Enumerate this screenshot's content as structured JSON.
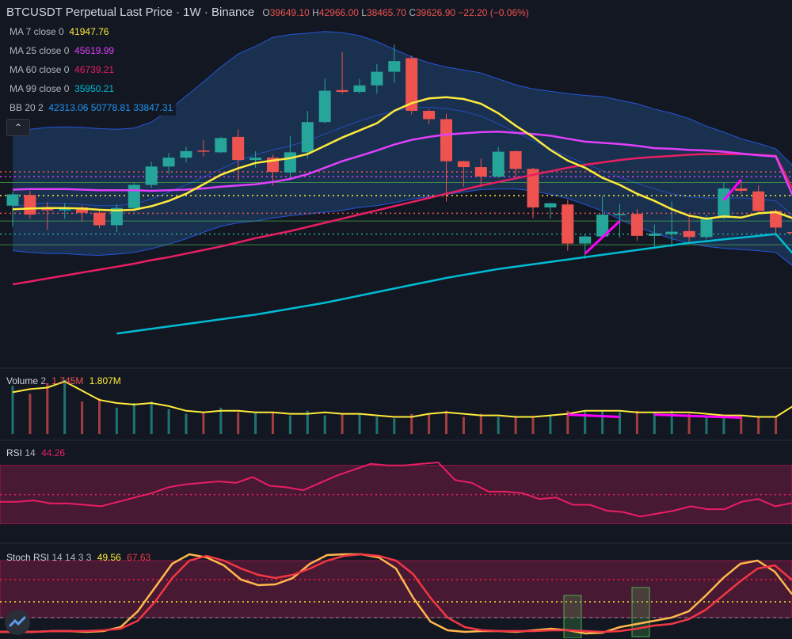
{
  "header": {
    "symbol": "BTCUSDT Perpetual Last Price",
    "interval": "1W",
    "exchange": "Binance",
    "open_label": "O",
    "open": "39649.10",
    "high_label": "H",
    "high": "42966.00",
    "low_label": "L",
    "low": "38465.70",
    "close_label": "C",
    "close": "39626.90",
    "change": "−22.20 (−0.06%)"
  },
  "indicators": {
    "ma7": {
      "label": "MA 7 close 0",
      "value": "41947.76",
      "color": "#ffeb3b"
    },
    "ma25": {
      "label": "MA 25 close 0",
      "value": "45619.99",
      "color": "#e040fb"
    },
    "ma60": {
      "label": "MA 60 close 0",
      "value": "46739.21",
      "color": "#e91e63"
    },
    "ma99": {
      "label": "MA 99 close 0",
      "value": "35950.21",
      "color": "#00bcd4"
    },
    "bb": {
      "label": "BB 20 2",
      "basis": "42313.06",
      "upper": "50778.81",
      "lower": "33847.31",
      "color": "#2196f3"
    }
  },
  "volume": {
    "label": "Volume",
    "length": "2",
    "value": "1.745M",
    "ma_value": "1.807M"
  },
  "rsi": {
    "label": "RSI",
    "length": "14",
    "value": "44.26"
  },
  "stoch": {
    "label": "Stoch RSI",
    "params": "14 14 3 3",
    "k": "49.56",
    "d": "67.63"
  },
  "colors": {
    "up": "#26a69a",
    "down": "#ef5350",
    "background": "#131722",
    "bb_fill": "#1e3a5f"
  },
  "chart_data": {
    "type": "candlestick",
    "candles": [
      {
        "o": 44100,
        "h": 46500,
        "l": 40600,
        "c": 46000
      },
      {
        "o": 45900,
        "h": 46600,
        "l": 41900,
        "c": 42600
      },
      {
        "o": 43800,
        "h": 44700,
        "l": 40000,
        "c": 43300
      },
      {
        "o": 43300,
        "h": 44500,
        "l": 41900,
        "c": 43800
      },
      {
        "o": 43800,
        "h": 44100,
        "l": 41400,
        "c": 42900
      },
      {
        "o": 42900,
        "h": 43400,
        "l": 40300,
        "c": 40800
      },
      {
        "o": 40800,
        "h": 44300,
        "l": 39600,
        "c": 43700
      },
      {
        "o": 43700,
        "h": 48000,
        "l": 43100,
        "c": 47600
      },
      {
        "o": 47600,
        "h": 51500,
        "l": 47100,
        "c": 50700
      },
      {
        "o": 50700,
        "h": 53000,
        "l": 49500,
        "c": 52200
      },
      {
        "o": 52200,
        "h": 54000,
        "l": 51400,
        "c": 53300
      },
      {
        "o": 53400,
        "h": 55200,
        "l": 52400,
        "c": 53300
      },
      {
        "o": 53100,
        "h": 55700,
        "l": 53000,
        "c": 55500
      },
      {
        "o": 55700,
        "h": 57000,
        "l": 48300,
        "c": 51800
      },
      {
        "o": 51800,
        "h": 53300,
        "l": 50500,
        "c": 52200
      },
      {
        "o": 52200,
        "h": 52700,
        "l": 47500,
        "c": 49800
      },
      {
        "o": 49700,
        "h": 55900,
        "l": 48600,
        "c": 53100
      },
      {
        "o": 53100,
        "h": 60100,
        "l": 52000,
        "c": 58200
      },
      {
        "o": 58200,
        "h": 65500,
        "l": 58000,
        "c": 63500
      },
      {
        "o": 63600,
        "h": 70000,
        "l": 63000,
        "c": 63300
      },
      {
        "o": 63300,
        "h": 65500,
        "l": 63000,
        "c": 64400
      },
      {
        "o": 64400,
        "h": 68000,
        "l": 63000,
        "c": 66700
      },
      {
        "o": 66700,
        "h": 71300,
        "l": 64800,
        "c": 68500
      },
      {
        "o": 69000,
        "h": 69400,
        "l": 59500,
        "c": 60100
      },
      {
        "o": 60100,
        "h": 60400,
        "l": 57800,
        "c": 58700
      },
      {
        "o": 58700,
        "h": 59600,
        "l": 44800,
        "c": 51600
      },
      {
        "o": 51600,
        "h": 51700,
        "l": 47300,
        "c": 50600
      },
      {
        "o": 50600,
        "h": 52000,
        "l": 47200,
        "c": 49000
      },
      {
        "o": 49000,
        "h": 54000,
        "l": 48800,
        "c": 53200
      },
      {
        "o": 53300,
        "h": 53400,
        "l": 48700,
        "c": 50300
      },
      {
        "o": 50300,
        "h": 50500,
        "l": 42000,
        "c": 43800
      },
      {
        "o": 43800,
        "h": 44500,
        "l": 41900,
        "c": 44500
      },
      {
        "o": 44300,
        "h": 45100,
        "l": 36500,
        "c": 37700
      },
      {
        "o": 37700,
        "h": 39300,
        "l": 35100,
        "c": 38900
      },
      {
        "o": 38900,
        "h": 45700,
        "l": 38600,
        "c": 42600
      },
      {
        "o": 42600,
        "h": 44400,
        "l": 38700,
        "c": 42700
      },
      {
        "o": 42700,
        "h": 43500,
        "l": 38200,
        "c": 39000
      },
      {
        "o": 39000,
        "h": 40900,
        "l": 37200,
        "c": 39400
      },
      {
        "o": 39300,
        "h": 44800,
        "l": 37100,
        "c": 39700
      },
      {
        "o": 39800,
        "h": 42400,
        "l": 37600,
        "c": 38800
      },
      {
        "o": 38800,
        "h": 42600,
        "l": 38400,
        "c": 42000
      },
      {
        "o": 42000,
        "h": 48000,
        "l": 41800,
        "c": 47000
      },
      {
        "o": 47000,
        "h": 48200,
        "l": 46000,
        "c": 46600
      },
      {
        "o": 46500,
        "h": 47500,
        "l": 42800,
        "c": 43200
      },
      {
        "o": 43200,
        "h": 43500,
        "l": 38900,
        "c": 40400
      },
      {
        "o": 39649.1,
        "h": 42966,
        "l": 38465.7,
        "c": 39626.9
      }
    ],
    "ma7": [
      43500,
      43600,
      43700,
      43700,
      43600,
      43400,
      43300,
      43400,
      44000,
      44900,
      46100,
      47700,
      49300,
      50400,
      51300,
      51700,
      52100,
      52800,
      54200,
      55600,
      56800,
      58000,
      60100,
      61400,
      62200,
      62400,
      62100,
      61300,
      59700,
      57600,
      55700,
      53500,
      51700,
      50500,
      48800,
      47600,
      46100,
      44900,
      43500,
      42400,
      41900,
      42300,
      42100,
      42800,
      43000,
      41947.76
    ],
    "ma25": [
      46800,
      46900,
      46900,
      46900,
      46800,
      46700,
      46700,
      46700,
      46600,
      46700,
      46800,
      47000,
      47300,
      47500,
      47700,
      48100,
      48600,
      49400,
      50500,
      51600,
      52500,
      53400,
      54400,
      55200,
      55700,
      56100,
      56300,
      56500,
      56600,
      56400,
      56200,
      55900,
      55400,
      54900,
      54700,
      54500,
      54200,
      53800,
      53700,
      53500,
      53400,
      53200,
      52900,
      52600,
      52400,
      45619.99
    ],
    "ma60": [
      30800,
      31300,
      31800,
      32300,
      32800,
      33300,
      33800,
      34300,
      34900,
      35400,
      36000,
      36600,
      37200,
      37900,
      38600,
      39200,
      39800,
      40500,
      41200,
      41900,
      42600,
      43300,
      44000,
      44700,
      45400,
      46100,
      46800,
      47500,
      48100,
      48700,
      49300,
      49900,
      50500,
      51000,
      51400,
      51800,
      52100,
      52300,
      52500,
      52700,
      52800,
      52800,
      52800,
      52700,
      52500,
      46739.21
    ],
    "ma99_start_index": 6,
    "ma99": [
      22500,
      22900,
      23300,
      23700,
      24100,
      24500,
      24900,
      25300,
      25700,
      26200,
      26700,
      27200,
      27700,
      28300,
      28900,
      29500,
      30100,
      30700,
      31300,
      31900,
      32400,
      32900,
      33400,
      33800,
      34200,
      34600,
      35000,
      35400,
      35800,
      36200,
      36600,
      37000,
      37400,
      37800,
      38100,
      38400,
      38700,
      39000,
      39300,
      35950.21
    ],
    "bb_basis": [
      44000,
      44300,
      44500,
      44500,
      44300,
      44100,
      44100,
      44400,
      45200,
      46400,
      47600,
      48900,
      50300,
      51600,
      52700,
      53500,
      54200,
      55000,
      56200,
      57300,
      58400,
      59300,
      60100,
      60600,
      60700,
      60500,
      60000,
      59200,
      57900,
      56500,
      55100,
      53700,
      52400,
      51200,
      50000,
      48900,
      47900,
      46900,
      46100,
      45600,
      45400,
      45400,
      45400,
      45200,
      44900,
      42313.06
    ],
    "bb_upper": [
      56500,
      57000,
      57300,
      57400,
      57300,
      57100,
      57000,
      57200,
      58200,
      60200,
      62600,
      65000,
      67500,
      69700,
      71000,
      72500,
      73000,
      73200,
      73500,
      73300,
      72800,
      71800,
      70500,
      69200,
      68200,
      67500,
      67000,
      66500,
      65500,
      64500,
      63800,
      63400,
      63000,
      62700,
      62500,
      61900,
      61300,
      60400,
      59700,
      58800,
      57500,
      56500,
      55400,
      54600,
      53700,
      50778.81
    ],
    "bb_lower": [
      36500,
      36200,
      36000,
      36000,
      35800,
      35700,
      35900,
      36200,
      36800,
      37600,
      38500,
      39600,
      40600,
      41200,
      41500,
      42000,
      42400,
      42700,
      43000,
      43300,
      43800,
      44100,
      44600,
      45200,
      45600,
      46000,
      46400,
      46800,
      46900,
      46900,
      46600,
      46000,
      45300,
      44300,
      43200,
      41800,
      40500,
      39500,
      38500,
      37800,
      37200,
      36900,
      36700,
      36500,
      36200,
      33847.31
    ],
    "volume": [
      3.1,
      2.6,
      3.3,
      3.5,
      2.1,
      2.3,
      1.7,
      2.0,
      2.1,
      1.6,
      1.3,
      1.4,
      1.7,
      1.4,
      1.4,
      1.4,
      1.2,
      1.5,
      1.2,
      1.3,
      1.3,
      1.1,
      1.0,
      1.3,
      1.3,
      1.5,
      1.1,
      1.3,
      1.1,
      1.1,
      1.1,
      1.2,
      1.5,
      1.5,
      1.5,
      1.4,
      1.5,
      1.4,
      1.5,
      1.3,
      1.2,
      1.2,
      1.2,
      1.1,
      1.1,
      1.745
    ],
    "volume_ma": [
      2.7,
      2.9,
      3.0,
      3.4,
      2.8,
      2.2,
      2.0,
      1.9,
      2.0,
      1.8,
      1.5,
      1.4,
      1.5,
      1.5,
      1.4,
      1.4,
      1.3,
      1.3,
      1.4,
      1.3,
      1.3,
      1.2,
      1.1,
      1.1,
      1.3,
      1.4,
      1.3,
      1.2,
      1.2,
      1.1,
      1.1,
      1.2,
      1.3,
      1.5,
      1.5,
      1.5,
      1.4,
      1.4,
      1.4,
      1.4,
      1.3,
      1.2,
      1.2,
      1.1,
      1.1,
      1.807
    ],
    "volume_ylim": [
      0,
      4.0
    ],
    "rsi": [
      45,
      45,
      46,
      44,
      44,
      43,
      42,
      45,
      48,
      51,
      55,
      57,
      58,
      59,
      58,
      62,
      56,
      55,
      53,
      58,
      63,
      67,
      71,
      70,
      70,
      71,
      72,
      60,
      58,
      52,
      52,
      51,
      47,
      48,
      43,
      43,
      39,
      38,
      35,
      37,
      39,
      42,
      40,
      40,
      45,
      47,
      42,
      44.26
    ],
    "rsi_ylim": [
      20,
      85
    ],
    "rsi_levels": [
      70,
      50,
      30
    ],
    "stoch_k": [
      2,
      2,
      2,
      3,
      3,
      2,
      3,
      8,
      28,
      58,
      88,
      100,
      96,
      86,
      68,
      61,
      62,
      70,
      88,
      99,
      100,
      100,
      96,
      82,
      45,
      15,
      4,
      2,
      3,
      3,
      2,
      4,
      6,
      4,
      0,
      1,
      8,
      12,
      16,
      20,
      28,
      48,
      70,
      88,
      92,
      78,
      49.56
    ],
    "stoch_d": [
      2,
      2,
      2,
      3,
      3,
      3,
      4,
      6,
      16,
      40,
      70,
      92,
      98,
      92,
      82,
      74,
      70,
      74,
      82,
      92,
      98,
      100,
      98,
      92,
      75,
      45,
      20,
      8,
      4,
      3,
      3,
      3,
      4,
      4,
      3,
      2,
      3,
      6,
      10,
      12,
      18,
      30,
      48,
      66,
      82,
      86,
      67.63
    ],
    "stoch_ylim": [
      0,
      100
    ],
    "stoch_levels": [
      80,
      50,
      20
    ]
  }
}
